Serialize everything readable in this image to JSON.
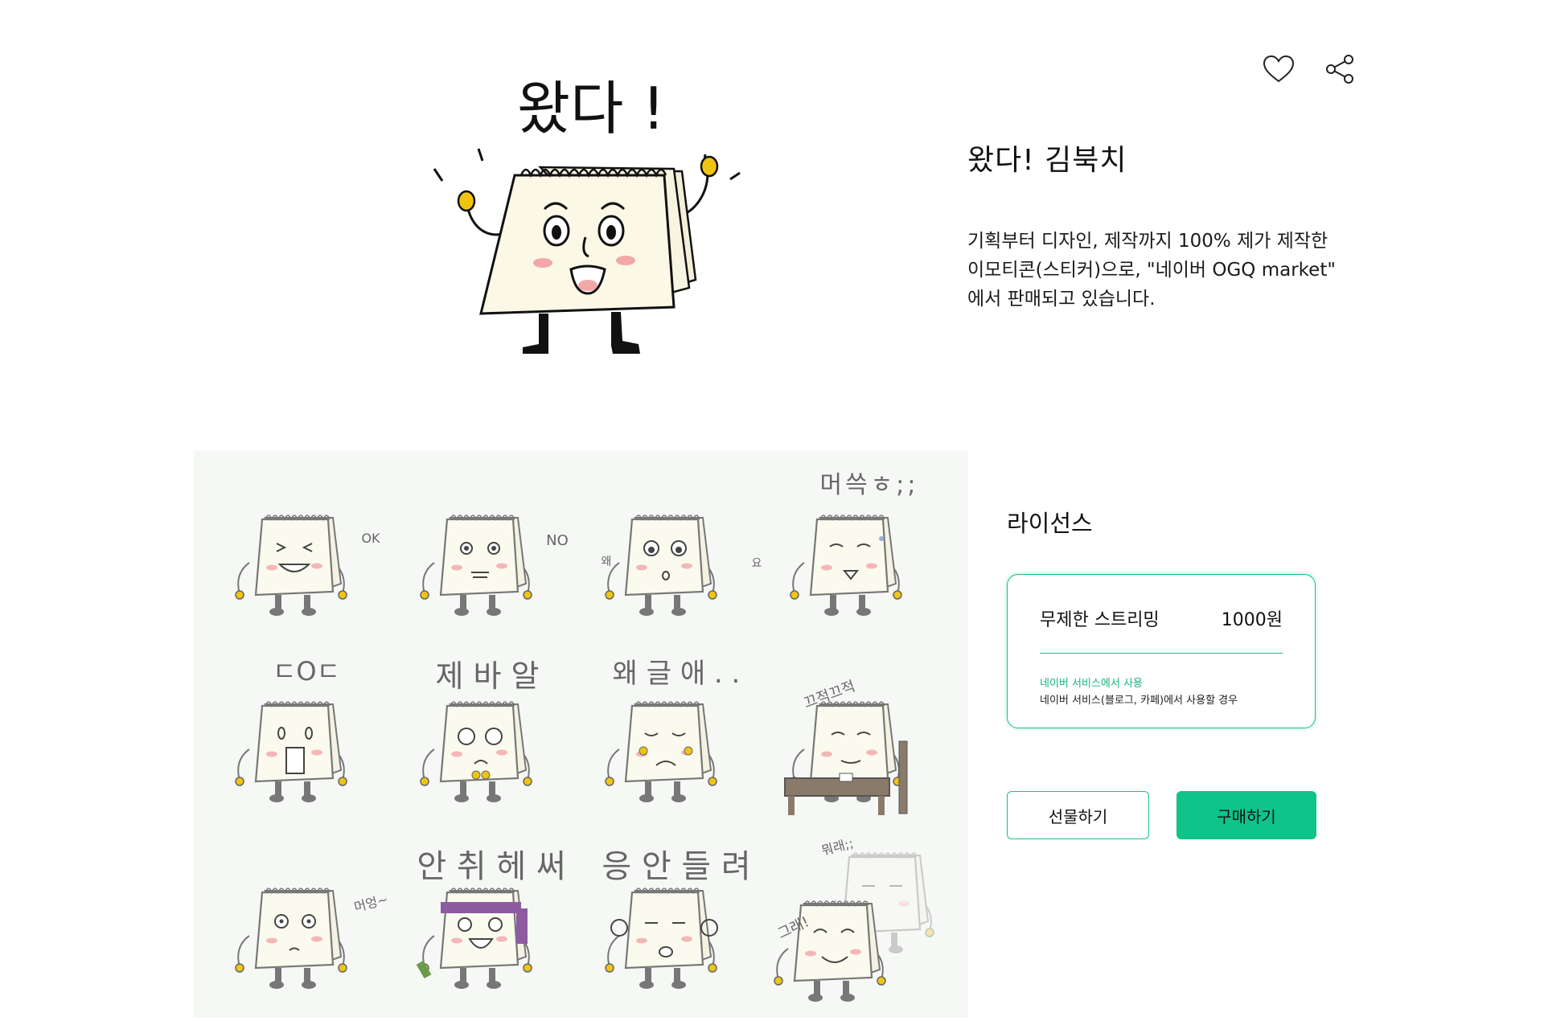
{
  "actions": {
    "like_icon": "heart-icon",
    "share_icon": "share-icon"
  },
  "hero": {
    "caption": "왔다 !"
  },
  "product": {
    "title": "왔다! 김북치",
    "description_lines": [
      "기획부터 디자인, 제작까지 100% 제가 제작한",
      "이모티콘(스티커)으로, \"네이버 OGQ market\"",
      "에서 판매되고 있습니다."
    ]
  },
  "preview": {
    "background": "#f6f8f6",
    "captions": {
      "r1c4": "머쓱ㅎ;;",
      "r2c1": "ㄷOㄷ",
      "r2c2": "제 바 알",
      "r2c3": "왜 글 애 . .",
      "r2c4": "끄적끄적",
      "r3c2": "안 취 헤 써",
      "r3c3": "응 안 들 려",
      "r3c4a": "뭐래;;",
      "r3c4b": "그래!",
      "r1c1_side": "OK",
      "r1c2_side": "NO",
      "r1c3_side": "요",
      "r1c3_side2": "왜",
      "r3c1_side": "머엉~"
    }
  },
  "license": {
    "heading": "라이선스",
    "option_name": "무제한 스트리밍",
    "price": "1000원",
    "scope": "네이버 서비스에서 사용",
    "detail": "네이버 서비스(블로그, 카페)에서 사용할 경우"
  },
  "buttons": {
    "gift": "선물하기",
    "buy": "구매하기"
  },
  "colors": {
    "accent": "#16c08a",
    "buy_button": "#0fc389",
    "sticker_yellow": "#f1c40f",
    "sticker_paper": "#fbf8e6",
    "blush": "#f4a7a7"
  }
}
